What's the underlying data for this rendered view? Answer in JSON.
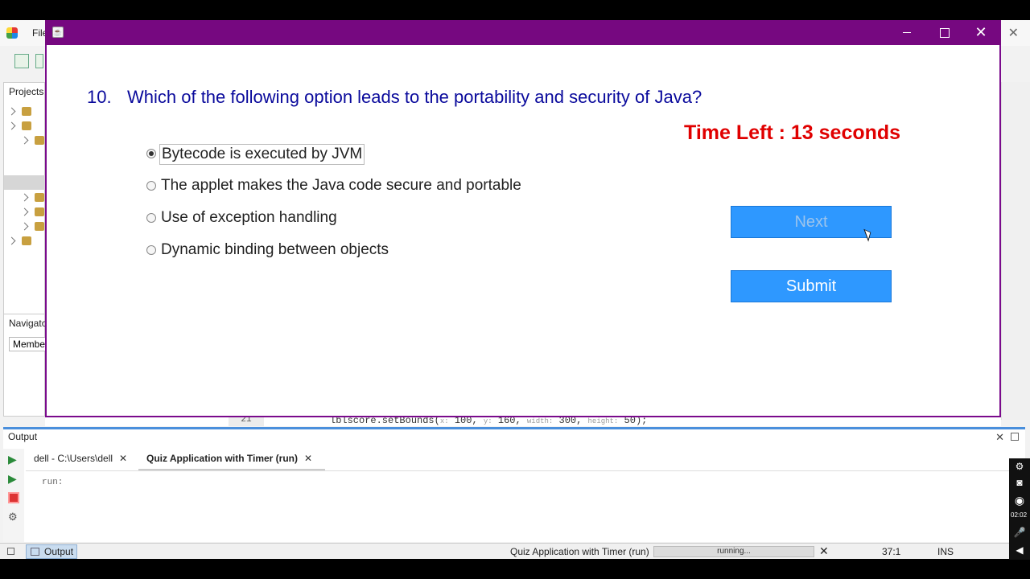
{
  "ide": {
    "menu_file": "File",
    "projects_title": "Projects",
    "navigator_title": "Navigator",
    "members_label": "Members",
    "editor": {
      "line_number": "21",
      "code_prefix": "lblscore.setBounds(",
      "hint_x": "x:",
      "val_x": "100",
      "hint_y": "y:",
      "val_y": "160",
      "hint_width": "width:",
      "val_width": "300",
      "hint_height": "height:",
      "val_height": "50",
      "code_suffix": ");"
    },
    "output": {
      "title": "Output",
      "tabs": [
        {
          "label": "dell - C:\\Users\\dell"
        },
        {
          "label": "Quiz Application with Timer (run)"
        }
      ],
      "text": "run:"
    },
    "statusbar": {
      "output_label": "Output",
      "task": "Quiz Application with Timer (run)",
      "progress_text": "running...",
      "position": "37:1",
      "mode": "INS"
    },
    "recorder": {
      "time": "02:02"
    }
  },
  "quiz": {
    "question_number": "10.",
    "question_text": "Which of the following option leads to the portability and security of Java?",
    "timer_text": "Time Left : 13 seconds",
    "options": [
      {
        "label": "Bytecode is executed by JVM",
        "selected": true
      },
      {
        "label": "The applet makes the Java code secure and portable",
        "selected": false
      },
      {
        "label": "Use of exception handling",
        "selected": false
      },
      {
        "label": "Dynamic binding between objects",
        "selected": false
      }
    ],
    "next_label": "Next",
    "submit_label": "Submit",
    "colors": {
      "titlebar": "#760880",
      "question": "#0a0a9c",
      "timer": "#e00000",
      "button": "#2e98ff"
    }
  }
}
